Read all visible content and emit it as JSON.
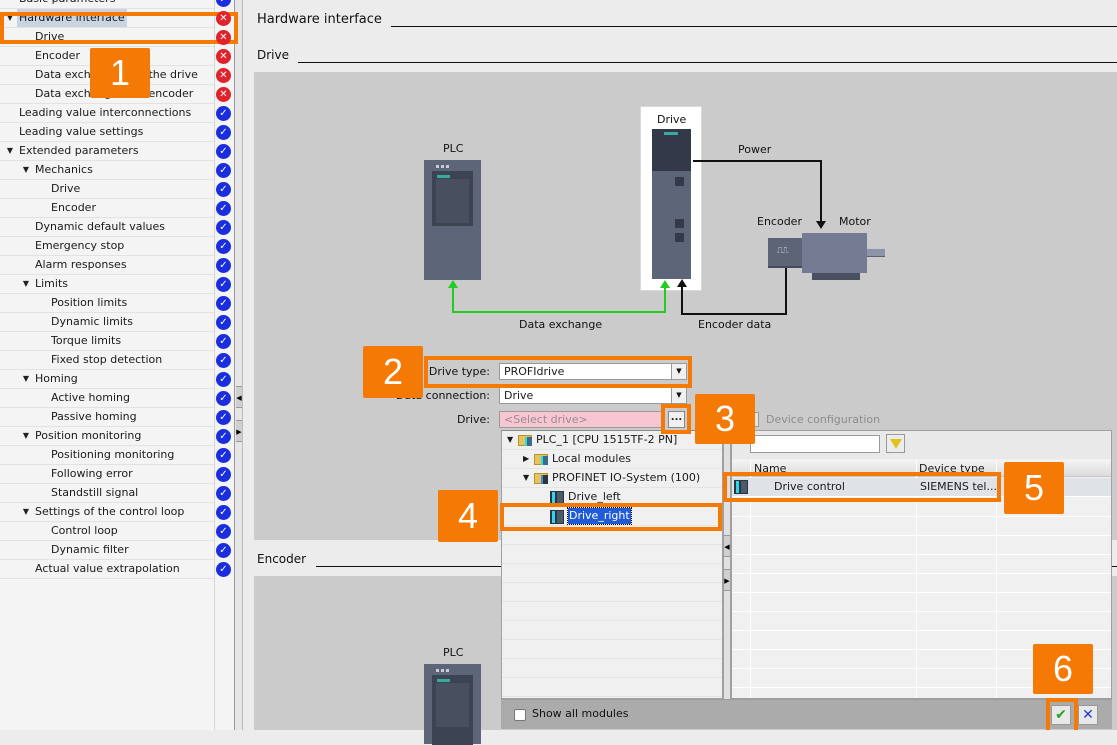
{
  "tree": {
    "items": [
      {
        "label": "Basic parameters",
        "level": 0,
        "expanded": null,
        "status": "ok"
      },
      {
        "label": "Hardware interface",
        "level": 0,
        "expanded": true,
        "status": "error",
        "selected": true
      },
      {
        "label": "Drive",
        "level": 1,
        "expanded": null,
        "status": "error"
      },
      {
        "label": "Encoder",
        "level": 1,
        "expanded": null,
        "status": "error"
      },
      {
        "label": "Data exchange with the drive",
        "level": 1,
        "expanded": null,
        "status": "error"
      },
      {
        "label": "Data exchange with encoder",
        "level": 1,
        "expanded": null,
        "status": "error"
      },
      {
        "label": "Leading value interconnections",
        "level": 0,
        "expanded": null,
        "status": "ok"
      },
      {
        "label": "Leading value settings",
        "level": 0,
        "expanded": null,
        "status": "ok"
      },
      {
        "label": "Extended parameters",
        "level": 0,
        "expanded": true,
        "status": "ok"
      },
      {
        "label": "Mechanics",
        "level": 1,
        "expanded": true,
        "status": "ok"
      },
      {
        "label": "Drive",
        "level": 2,
        "expanded": null,
        "status": "ok"
      },
      {
        "label": "Encoder",
        "level": 2,
        "expanded": null,
        "status": "ok"
      },
      {
        "label": "Dynamic default values",
        "level": 1,
        "expanded": null,
        "status": "ok"
      },
      {
        "label": "Emergency stop",
        "level": 1,
        "expanded": null,
        "status": "ok"
      },
      {
        "label": "Alarm responses",
        "level": 1,
        "expanded": null,
        "status": "ok"
      },
      {
        "label": "Limits",
        "level": 1,
        "expanded": true,
        "status": "ok"
      },
      {
        "label": "Position limits",
        "level": 2,
        "expanded": null,
        "status": "ok"
      },
      {
        "label": "Dynamic limits",
        "level": 2,
        "expanded": null,
        "status": "ok"
      },
      {
        "label": "Torque limits",
        "level": 2,
        "expanded": null,
        "status": "ok"
      },
      {
        "label": "Fixed stop detection",
        "level": 2,
        "expanded": null,
        "status": "ok"
      },
      {
        "label": "Homing",
        "level": 1,
        "expanded": true,
        "status": "ok"
      },
      {
        "label": "Active homing",
        "level": 2,
        "expanded": null,
        "status": "ok"
      },
      {
        "label": "Passive homing",
        "level": 2,
        "expanded": null,
        "status": "ok"
      },
      {
        "label": "Position monitoring",
        "level": 1,
        "expanded": true,
        "status": "ok"
      },
      {
        "label": "Positioning monitoring",
        "level": 2,
        "expanded": null,
        "status": "ok"
      },
      {
        "label": "Following error",
        "level": 2,
        "expanded": null,
        "status": "ok"
      },
      {
        "label": "Standstill signal",
        "level": 2,
        "expanded": null,
        "status": "ok"
      },
      {
        "label": "Settings of the control loop",
        "level": 1,
        "expanded": true,
        "status": "ok"
      },
      {
        "label": "Control loop",
        "level": 2,
        "expanded": null,
        "status": "ok"
      },
      {
        "label": "Dynamic filter",
        "level": 2,
        "expanded": null,
        "status": "ok"
      },
      {
        "label": "Actual value extrapolation",
        "level": 1,
        "expanded": null,
        "status": "ok"
      }
    ],
    "status_icons": {
      "ok": "check-circle-icon",
      "error": "error-circle-icon"
    },
    "status_colors": {
      "ok": "#1a2ee0",
      "error": "#e0222a"
    }
  },
  "main": {
    "title": "Hardware interface",
    "drive_section": {
      "title": "Drive",
      "diagram": {
        "plc_label": "PLC",
        "drive_label": "Drive",
        "power_label": "Power",
        "encoder_label": "Encoder",
        "motor_label": "Motor",
        "data_exchange_label": "Data exchange",
        "encoder_data_label": "Encoder data"
      },
      "form": {
        "drive_type_label": "Drive type:",
        "drive_type_value": "PROFIdrive",
        "data_connection_label": "Data connection:",
        "data_connection_value": "Drive",
        "drive_label": "Drive:",
        "drive_placeholder": "<Select drive>",
        "browse_label": "...",
        "device_config_label": "Device configuration"
      }
    },
    "encoder_section": {
      "title": "Encoder",
      "diagram": {
        "plc_label": "PLC"
      }
    }
  },
  "popup": {
    "tree": [
      {
        "label": "PLC_1 [CPU 1515TF-2 PN]",
        "icon": "plc-folder-icon",
        "expanded": true
      },
      {
        "label": "Local modules",
        "icon": "folder-icon",
        "expanded": false
      },
      {
        "label": "PROFINET IO-System (100)",
        "icon": "network-folder-icon",
        "expanded": true
      },
      {
        "label": "Drive_left",
        "icon": "drive-module-icon"
      },
      {
        "label": "Drive_right",
        "icon": "drive-module-icon",
        "selected": true
      }
    ],
    "filter_value": "",
    "columns": [
      "Name",
      "Device type"
    ],
    "rows": [
      {
        "name": "Drive control",
        "device_type": "SIEMENS tel...",
        "selected": true
      }
    ],
    "show_all_modules_label": "Show all modules",
    "show_all_modules_checked": false,
    "ok_icon": "checkmark-icon",
    "cancel_icon": "close-icon"
  },
  "annotations": {
    "color": "#f47a05",
    "badges": [
      "1",
      "2",
      "3",
      "4",
      "5",
      "6"
    ]
  }
}
